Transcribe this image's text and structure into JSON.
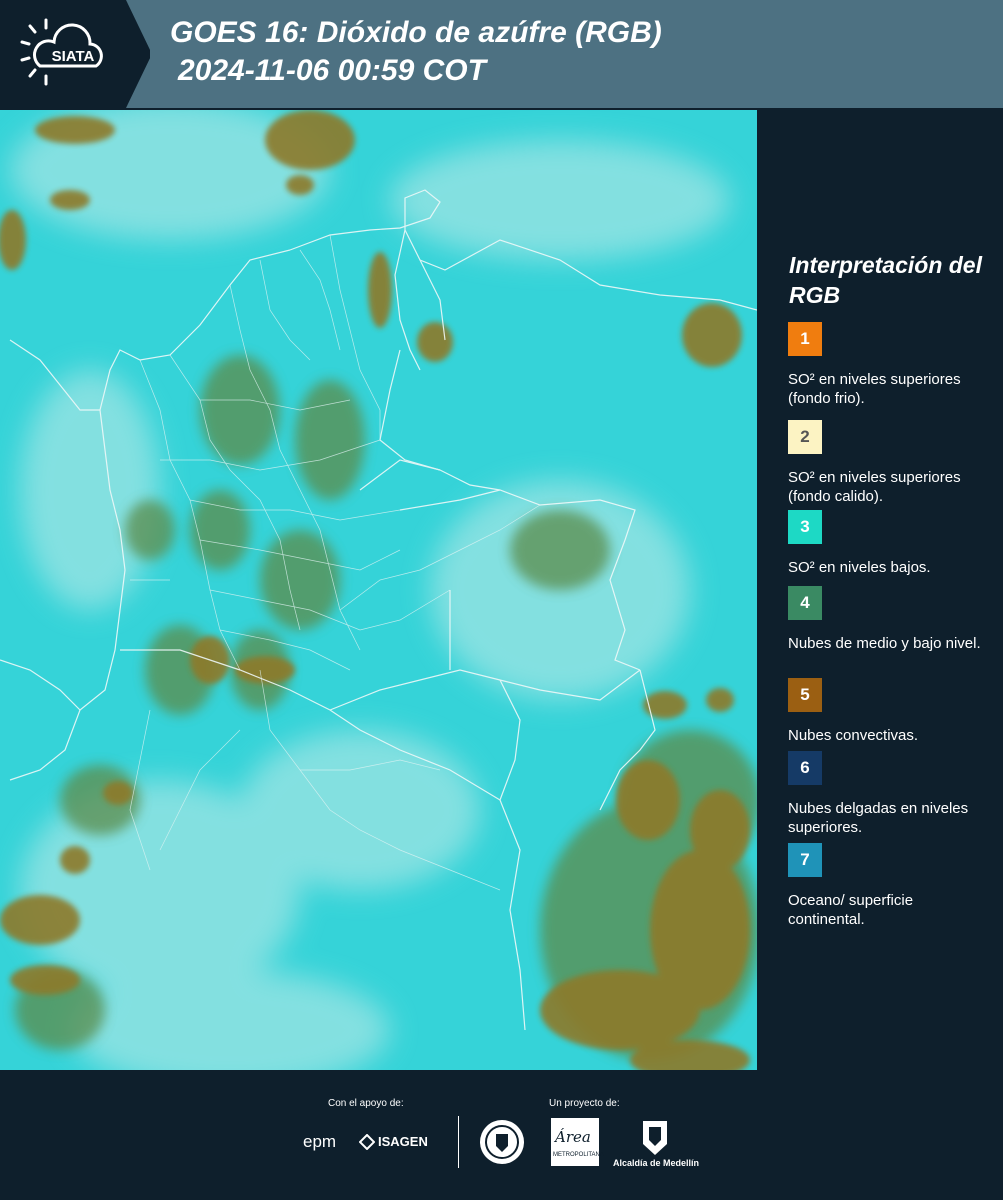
{
  "header": {
    "title_line1": "GOES 16: Dióxido de azúfre (RGB)",
    "title_line2": "2024-11-06 00:59 COT",
    "logo_text": "SIATA",
    "background_color": "#4d7182"
  },
  "legend": {
    "title": "Interpretación del RGB",
    "items": [
      {
        "number": "1",
        "color": "#f07d0f",
        "label": "SO² en niveles superiores (fondo frio)."
      },
      {
        "number": "2",
        "color": "#fcf3c3",
        "label": "SO² en niveles superiores (fondo calido)."
      },
      {
        "number": "3",
        "color": "#1dd9c5",
        "label": "SO² en niveles bajos."
      },
      {
        "number": "4",
        "color": "#3a8a63",
        "label": "Nubes de medio y bajo nivel."
      },
      {
        "number": "5",
        "color": "#9b5f12",
        "label": "Nubes convectivas."
      },
      {
        "number": "6",
        "color": "#153a66",
        "label": "Nubes delgadas en niveles superiores."
      },
      {
        "number": "7",
        "color": "#1f93b8",
        "label": "Oceano/ superficie continental."
      }
    ]
  },
  "footer": {
    "support_label": "Con el apoyo de:",
    "project_label": "Un proyecto de:",
    "sponsor_epm": "epm",
    "sponsor_isagen": "ISAGEN",
    "area_text": "Área",
    "area_subtext": "METROPOLITANA",
    "alcaldia_text": "Alcaldía de Medellín"
  },
  "map": {
    "background_color": "#35d3d8",
    "cloud_colors": [
      "#8d7a2b",
      "#5e8a4a",
      "#bfe7e6"
    ]
  }
}
